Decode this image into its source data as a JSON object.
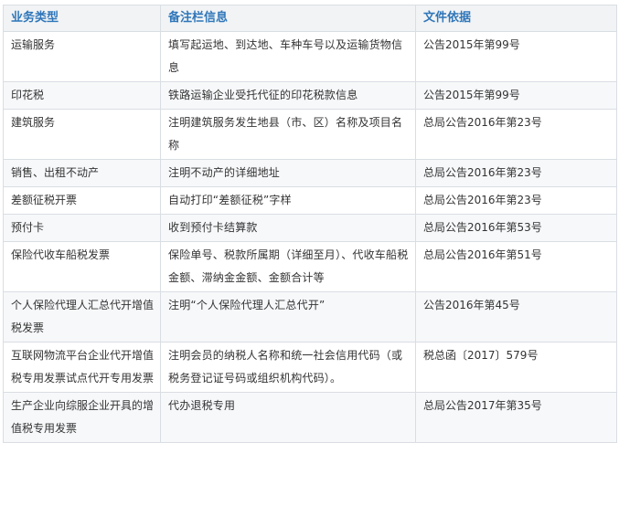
{
  "headers": [
    "业务类型",
    "备注栏信息",
    "文件依据"
  ],
  "rows": [
    {
      "type": "运输服务",
      "note": "填写起运地、到达地、车种车号以及运输货物信息",
      "basis": "公告2015年第99号"
    },
    {
      "type": "印花税",
      "note": "铁路运输企业受托代征的印花税款信息",
      "basis": "公告2015年第99号"
    },
    {
      "type": "建筑服务",
      "note": "注明建筑服务发生地县（市、区）名称及项目名称",
      "basis": "总局公告2016年第23号"
    },
    {
      "type": "销售、出租不动产",
      "note": "注明不动产的详细地址",
      "basis": "总局公告2016年第23号"
    },
    {
      "type": "差额征税开票",
      "note": "自动打印“差额征税”字样",
      "basis": "总局公告2016年第23号"
    },
    {
      "type": "预付卡",
      "note": "收到预付卡结算款",
      "basis": "总局公告2016年第53号"
    },
    {
      "type": "保险代收车船税发票",
      "note": "保险单号、税款所属期（详细至月）、代收车船税金额、滞纳金金额、金额合计等",
      "basis": "总局公告2016年第51号"
    },
    {
      "type": "个人保险代理人汇总代开增值税发票",
      "note": "注明“个人保险代理人汇总代开”",
      "basis": "公告2016年第45号"
    },
    {
      "type": "互联网物流平台企业代开增值税专用发票试点代开专用发票",
      "note": "注明会员的纳税人名称和统一社会信用代码（或税务登记证号码或组织机构代码）。",
      "basis": "税总函〔2017〕579号"
    },
    {
      "type": "生产企业向综服企业开具的增值税专用发票",
      "note": "代办退税专用",
      "basis": "总局公告2017年第35号"
    }
  ]
}
